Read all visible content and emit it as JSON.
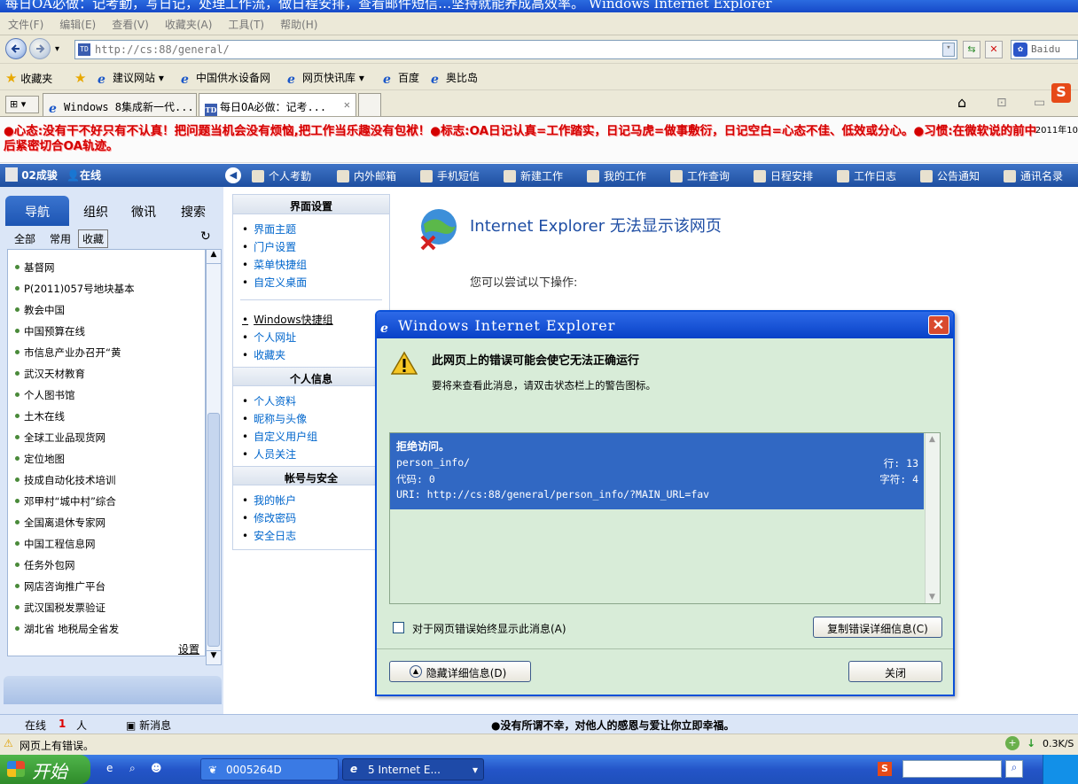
{
  "window": {
    "title": "每日OA必做：记考勤，写日记，处理工作流，做日程安排，查看邮件短信…坚持就能养成高效率。          Windows Internet Explorer"
  },
  "menubar": {
    "items": [
      "文件(F)",
      "编辑(E)",
      "查看(V)",
      "收藏夹(A)",
      "工具(T)",
      "帮助(H)"
    ]
  },
  "address": {
    "url": "http://cs:88/general/",
    "search_placeholder": "Baidu",
    "favicon_text": "TD"
  },
  "favorites": {
    "label": "收藏夹",
    "items": [
      "建议网站 ▾",
      "中国供水设备网",
      "网页快讯库 ▾",
      "百度",
      "奥比岛"
    ]
  },
  "tabs": [
    {
      "label": "Windows 8集成新一代..."
    },
    {
      "label": "每日OA必做：记考..."
    }
  ],
  "banner": {
    "text": "●心态:没有干不好只有不认真！把问题当机会没有烦恼,把工作当乐趣没有包袱！●标志:OA日记认真=工作踏实，日记马虎=做事敷衍，日记空白=心态不佳、低效或分心。●习惯:在微软说的前中后紧密切合OA轨迹。",
    "date": "2011年10"
  },
  "oabar": {
    "user": "02成骏",
    "status": "在线",
    "items": [
      "个人考勤",
      "内外邮箱",
      "手机短信",
      "新建工作",
      "我的工作",
      "工作查询",
      "日程安排",
      "工作日志",
      "公告通知",
      "通讯名录"
    ]
  },
  "left": {
    "tabs": [
      "导航",
      "组织",
      "微讯",
      "搜索"
    ],
    "subtabs": [
      "全部",
      "常用",
      "收藏"
    ],
    "items": [
      "基督网",
      "P(2011)057号地块基本",
      "教会中国",
      "中国预算在线",
      "市信息产业办召开“黄",
      "武汉天材教育",
      "个人图书馆",
      "土木在线",
      "全球工业品现货网",
      "定位地图",
      "技成自动化技术培训",
      "邓甲村“城中村”综合",
      "全国离退休专家网",
      "中国工程信息网",
      "任务外包网",
      "网店咨询推广平台",
      "武汉国税发票验证",
      "湖北省 地税局全省发"
    ],
    "settings": "设置"
  },
  "middle": {
    "sections": [
      {
        "title": "界面设置",
        "links": [
          "界面主题",
          "门户设置",
          "菜单快捷组",
          "自定义桌面"
        ]
      },
      {
        "title": "",
        "links": [
          "Windows快捷组",
          "个人网址",
          "收藏夹"
        ]
      },
      {
        "title": "个人信息",
        "links": [
          "个人资料",
          "昵称与头像",
          "自定义用户组",
          "人员关注"
        ]
      },
      {
        "title": "帐号与安全",
        "links": [
          "我的帐户",
          "修改密码",
          "安全日志"
        ]
      }
    ]
  },
  "iepage": {
    "title": "Internet Explorer 无法显示该网页",
    "try": "您可以尝试以下操作:"
  },
  "dialog": {
    "title": "Windows Internet Explorer",
    "heading": "此网页上的错误可能会使它无法正确运行",
    "sub": "要将来查看此消息，请双击状态栏上的警告图标。",
    "detail": {
      "title": "拒绝访问。",
      "file": "person_info/",
      "line": "行: 13",
      "code": "代码: 0",
      "char": "字符: 4",
      "uri": "URI: http://cs:88/general/person_info/?MAIN_URL=fav"
    },
    "checkbox_label": "对于网页错误始终显示此消息(A)",
    "copy_button": "复制错误详细信息(C)",
    "hide_button": "隐藏详细信息(D)",
    "close_button": "关闭"
  },
  "oastatus": {
    "online_label": "在线",
    "online_count": "1",
    "unit": "人",
    "news": "新消息",
    "motto": "●没有所谓不幸，对他人的感恩与爱让你立即幸福。"
  },
  "iestatus": {
    "text": "网页上有错误。",
    "speed": "0.3K/S"
  },
  "taskbar": {
    "start": "开始",
    "items": [
      "0005264D",
      "5 Internet E..."
    ]
  }
}
